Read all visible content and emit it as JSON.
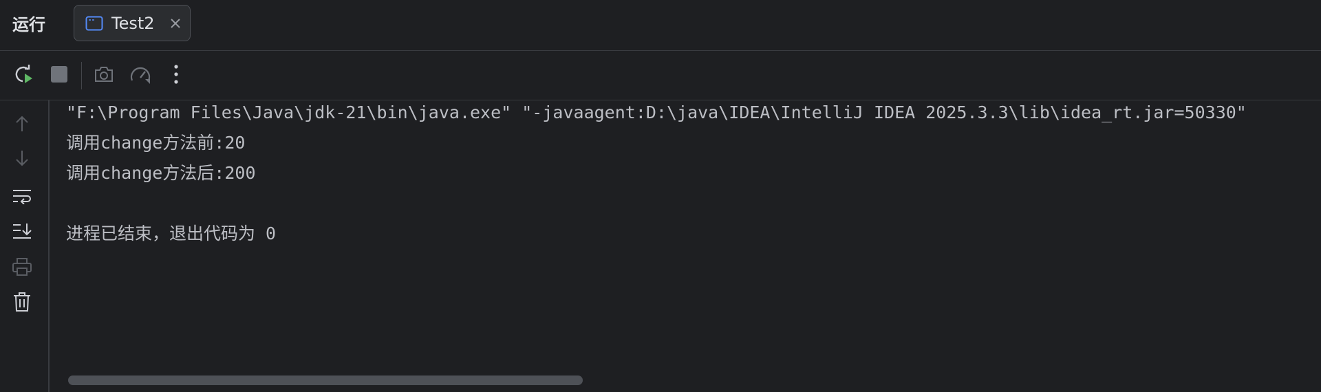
{
  "header": {
    "panel_title": "运行",
    "tab": {
      "label": "Test2",
      "icon": "console-window-icon",
      "close_icon": "close-icon"
    }
  },
  "toolbar": {
    "items": [
      {
        "name": "rerun-button",
        "icon": "rerun-icon"
      },
      {
        "name": "stop-button",
        "icon": "stop-icon"
      },
      {
        "name": "screenshot-button",
        "icon": "camera-icon"
      },
      {
        "name": "profiler-button",
        "icon": "gauge-icon"
      },
      {
        "name": "more-options-button",
        "icon": "vertical-dots-icon"
      }
    ]
  },
  "gutter": {
    "items": [
      {
        "name": "scroll-up-button",
        "icon": "arrow-up-icon"
      },
      {
        "name": "scroll-down-button",
        "icon": "arrow-down-icon"
      },
      {
        "name": "soft-wrap-button",
        "icon": "soft-wrap-icon"
      },
      {
        "name": "scroll-to-end-button",
        "icon": "scroll-to-end-icon"
      },
      {
        "name": "print-button",
        "icon": "printer-icon"
      },
      {
        "name": "clear-all-button",
        "icon": "trash-icon"
      }
    ]
  },
  "console": {
    "lines": [
      "\"F:\\Program Files\\Java\\jdk-21\\bin\\java.exe\" \"-javaagent:D:\\java\\IDEA\\IntelliJ IDEA 2025.3.3\\lib\\idea_rt.jar=50330\"",
      "调用change方法前:20",
      "调用change方法后:200",
      "",
      "进程已结束，退出代码为 0"
    ]
  },
  "colors": {
    "background": "#1e1f22",
    "text": "#bcbec4",
    "icon": "#ced0d6",
    "icon_disabled": "#6f737a",
    "run_green": "#5fb865",
    "tab_icon_blue": "#548af7"
  }
}
